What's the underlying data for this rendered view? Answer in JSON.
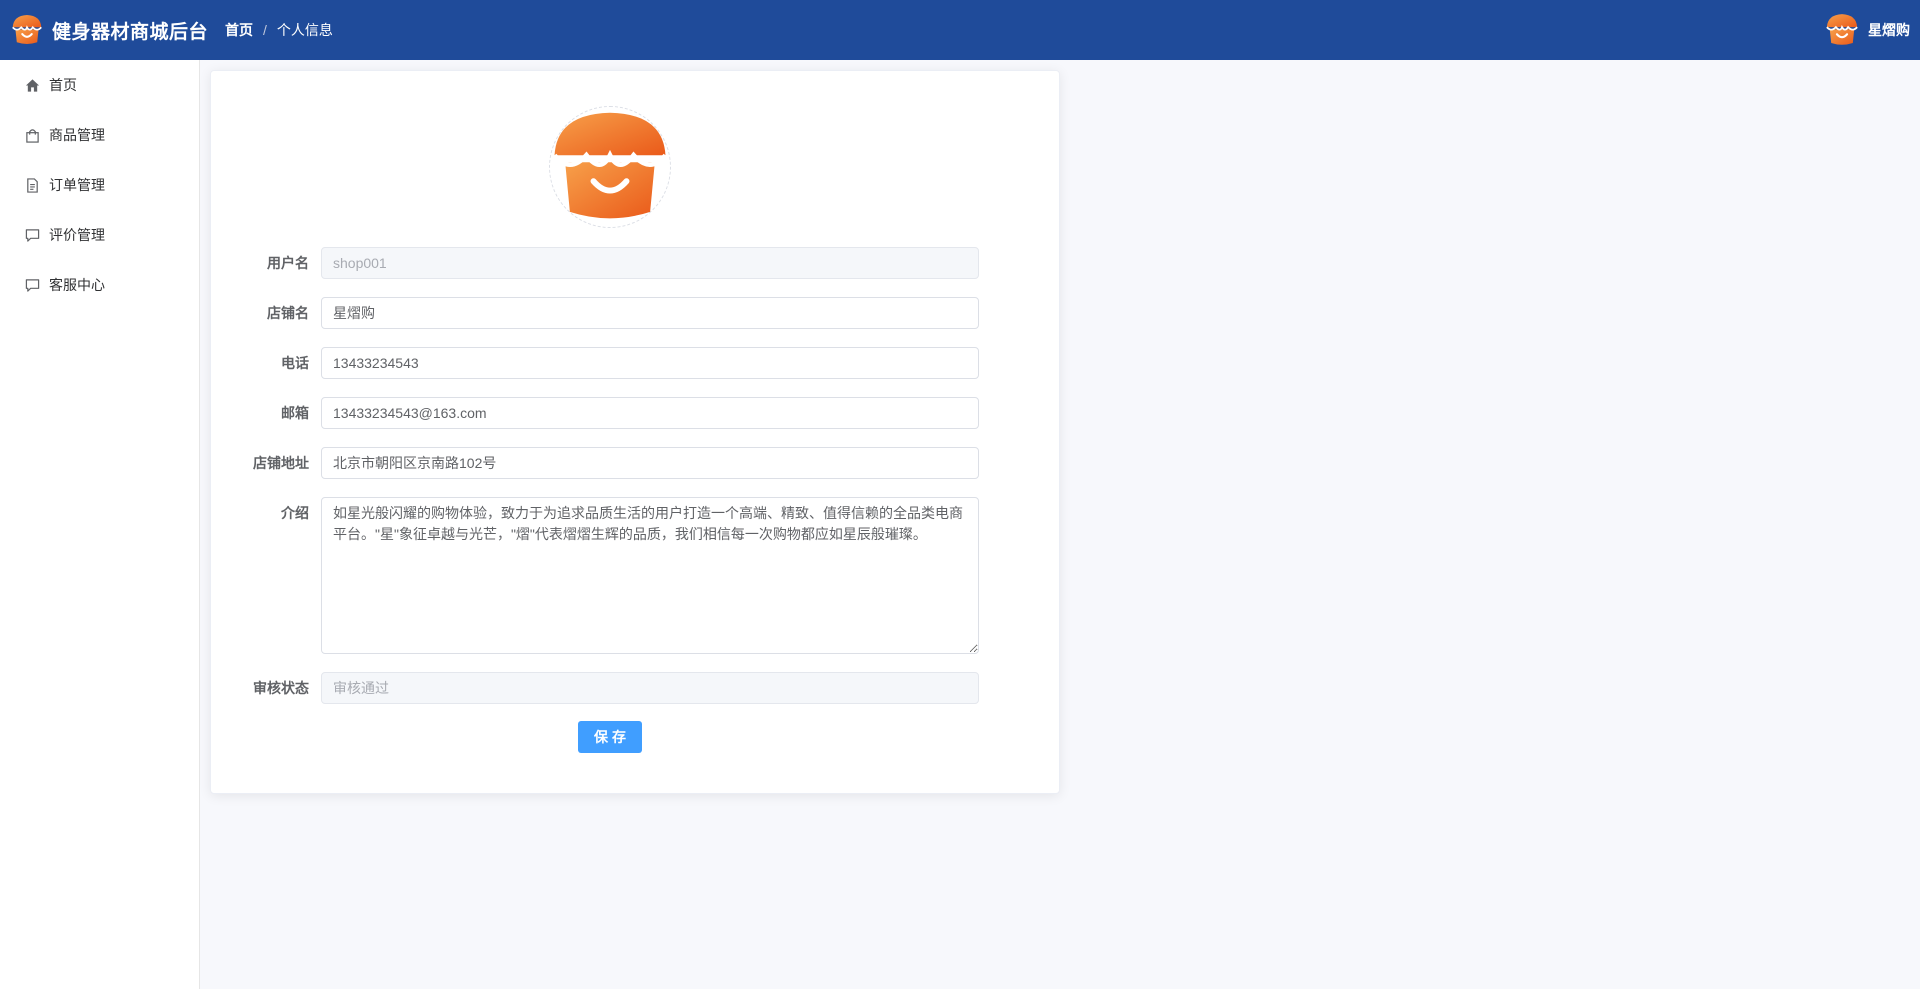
{
  "header": {
    "app_title": "健身器材商城后台",
    "breadcrumb": {
      "home": "首页",
      "separator": "/",
      "current": "个人信息"
    },
    "user_name": "星熠购",
    "background_color": "#1f4b9a"
  },
  "sidebar": {
    "items": [
      {
        "label": "首页",
        "icon": "home-icon"
      },
      {
        "label": "商品管理",
        "icon": "shopping-bag-icon"
      },
      {
        "label": "订单管理",
        "icon": "document-icon"
      },
      {
        "label": "评价管理",
        "icon": "chat-icon"
      },
      {
        "label": "客服中心",
        "icon": "chat-icon"
      }
    ]
  },
  "form": {
    "username": {
      "label": "用户名",
      "value": "shop001",
      "disabled": true
    },
    "shop_name": {
      "label": "店铺名",
      "value": "星熠购"
    },
    "phone": {
      "label": "电话",
      "value": "13433234543"
    },
    "email": {
      "label": "邮箱",
      "value": "13433234543@163.com"
    },
    "address": {
      "label": "店铺地址",
      "value": "北京市朝阳区京南路102号"
    },
    "intro": {
      "label": "介绍",
      "value": "如星光般闪耀的购物体验，致力于为追求品质生活的用户打造一个高端、精致、值得信赖的全品类电商平台。\"星\"象征卓越与光芒，\"熠\"代表熠熠生辉的品质，我们相信每一次购物都应如星辰般璀璨。"
    },
    "audit_status": {
      "label": "审核状态",
      "value": "审核通过",
      "disabled": true
    },
    "save_label": "保存"
  },
  "colors": {
    "primary": "#409eff",
    "logo_orange_light": "#f7a04a",
    "logo_orange_dark": "#ea5a1a"
  }
}
